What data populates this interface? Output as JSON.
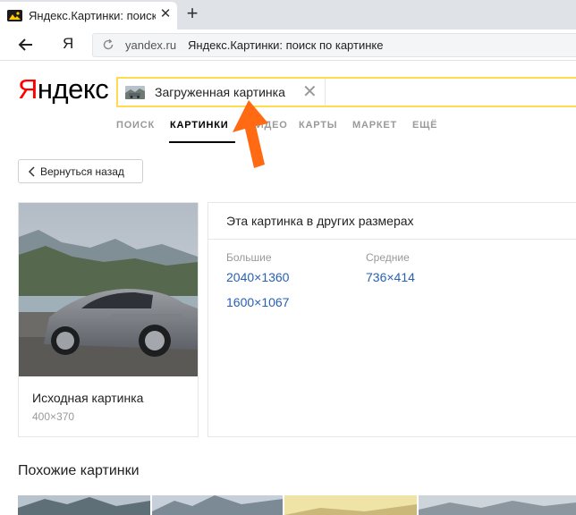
{
  "browser": {
    "tab_title": "Яндекс.Картинки: поиск",
    "tab_close": "✕",
    "new_tab": "+",
    "nav_ya": "Я",
    "address_domain": "yandex.ru",
    "address_title": "Яндекс.Картинки: поиск по картинке"
  },
  "logo": {
    "first_letter": "Я",
    "rest": "ндекс",
    "color_first": "#ff0000"
  },
  "search": {
    "label": "Загруженная картинка",
    "clear": "✕",
    "accent": "#ffdb4d"
  },
  "service_tabs": [
    {
      "label": "ПОИСК",
      "active": false
    },
    {
      "label": "КАРТИНКИ",
      "active": true
    },
    {
      "label": "ВИДЕО",
      "active": false
    },
    {
      "label": "КАРТЫ",
      "active": false
    },
    {
      "label": "МАРКЕТ",
      "active": false
    },
    {
      "label": "ЕЩЁ",
      "active": false
    }
  ],
  "back_button": {
    "label": "Вернуться назад"
  },
  "original": {
    "title": "Исходная картинка",
    "size": "400×370"
  },
  "sizes": {
    "title": "Эта картинка в других размерах",
    "large_heading": "Большие",
    "medium_heading": "Средние",
    "large": [
      "2040×1360",
      "1600×1067"
    ],
    "medium": [
      "736×414"
    ],
    "link_color": "#2760b4"
  },
  "similar": {
    "title": "Похожие картинки"
  },
  "annotation": {
    "arrow_color": "#ff6a13"
  }
}
